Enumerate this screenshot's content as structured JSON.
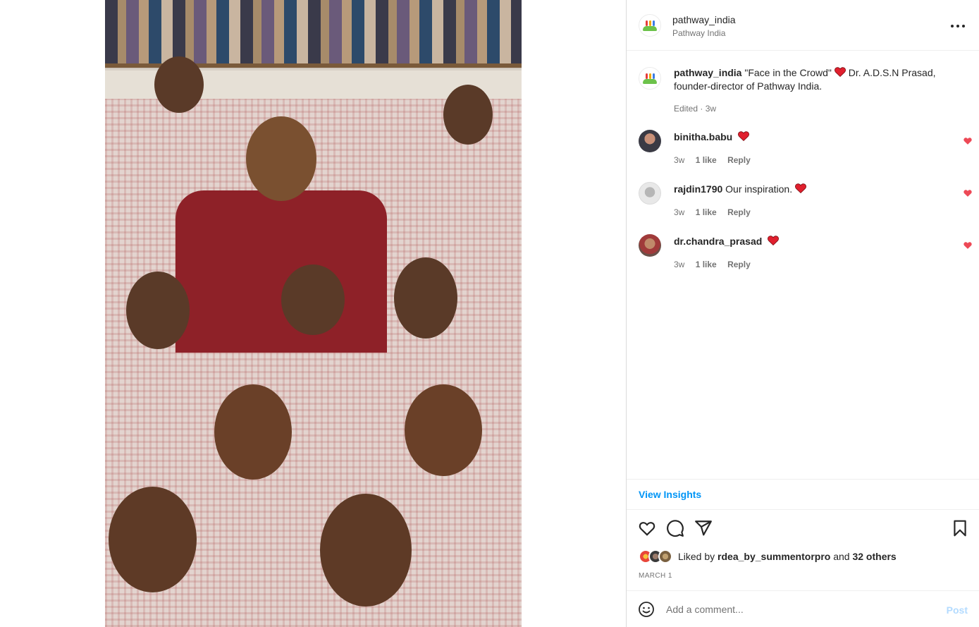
{
  "post": {
    "image_alt": "Group photo of children in checked uniforms with a man in a red shirt",
    "author": {
      "username": "pathway_india",
      "display_name": "Pathway India"
    },
    "caption": {
      "username": "pathway_india",
      "text_part1": "\"Face in the Crowd\"",
      "text_part2": " Dr. A.D.S.N Prasad, founder-director of Pathway India.",
      "meta": "Edited · 3w"
    },
    "comments": [
      {
        "username": "binitha.babu",
        "text": "",
        "has_heart": true,
        "age": "3w",
        "likes": "1 like",
        "reply": "Reply",
        "avatar_icon": "user-avatar-icon"
      },
      {
        "username": "rajdin1790",
        "text": "Our inspiration.",
        "has_heart": true,
        "age": "3w",
        "likes": "1 like",
        "reply": "Reply",
        "avatar_icon": "user-avatar-icon"
      },
      {
        "username": "dr.chandra_prasad",
        "text": "",
        "has_heart": true,
        "age": "3w",
        "likes": "1 like",
        "reply": "Reply",
        "avatar_icon": "user-avatar-icon"
      }
    ],
    "insights_label": "View Insights",
    "liked_by": {
      "prefix": "Liked by ",
      "user": "rdea_by_summentorpro",
      "middle": " and ",
      "others": "32 others"
    },
    "date": "MARCH 1",
    "add_comment": {
      "placeholder": "Add a comment...",
      "post_label": "Post"
    }
  },
  "icons": {
    "more": "more-options-icon",
    "like": "heart-icon",
    "comment": "comment-bubble-icon",
    "share": "send-paper-plane-icon",
    "save": "bookmark-icon",
    "emoji": "smiley-icon"
  },
  "colors": {
    "accent": "#0095f6",
    "heart": "#ed4956",
    "text": "#262626",
    "muted": "#737373"
  }
}
